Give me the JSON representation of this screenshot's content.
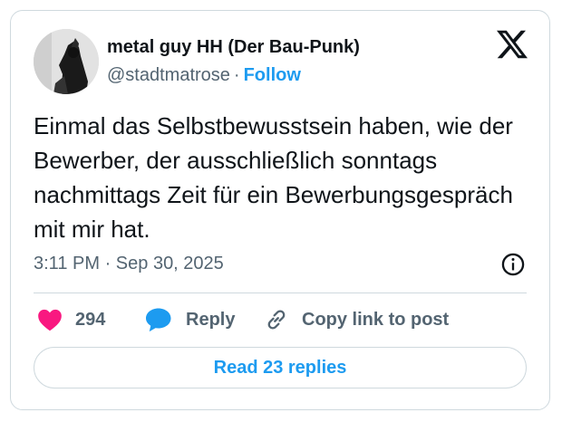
{
  "author": {
    "display_name": "metal guy HH (Der Bau-Punk)",
    "handle": "@stadtmatrose",
    "separator": "·",
    "follow_label": "Follow",
    "avatar_icon": "profile-photo-dark-figure"
  },
  "platform_icon": "x-logo-icon",
  "tweet": {
    "text": "Einmal das Selbstbewusstsein haben, wie der Bewerber, der ausschließlich sonntags nachmittags Zeit für ein Bewerbungsgespräch mit mir hat.",
    "time": "3:11 PM",
    "date": "Sep 30, 2025",
    "time_separator": "·"
  },
  "actions": {
    "like_count": "294",
    "reply_label": "Reply",
    "copy_label": "Copy link to post"
  },
  "read_replies_label": "Read 23 replies",
  "colors": {
    "accent": "#1d9bf0",
    "like": "#f91880",
    "text": "#0f1419",
    "muted": "#536471",
    "border": "#cfd9de"
  }
}
